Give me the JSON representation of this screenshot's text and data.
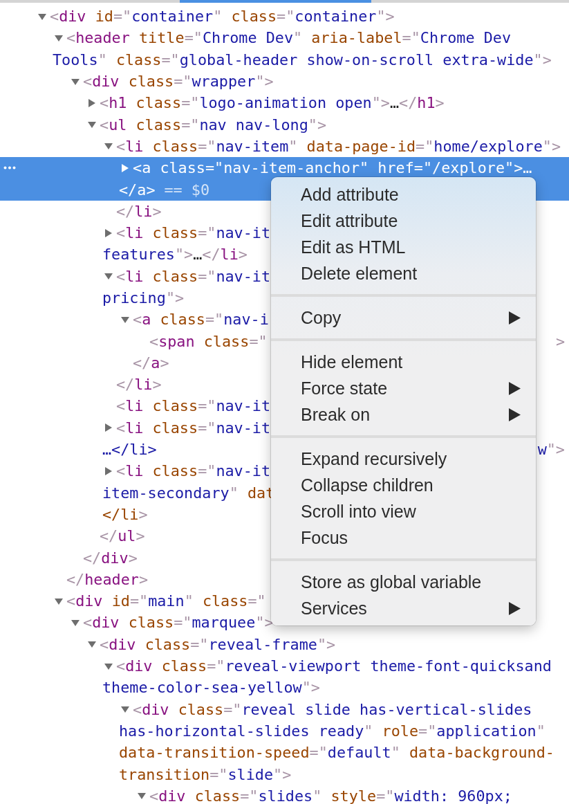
{
  "tree": [
    {
      "kind": "element",
      "expanded": true,
      "selected": false,
      "lines": [
        "<div id=\"container\" class=\"container\">"
      ],
      "children": [
        {
          "kind": "element",
          "expanded": true,
          "selected": false,
          "lines": [
            "<header title=\"Chrome Dev\" aria-label=\"Chrome Dev",
            "Tools\" class=\"global-header show-on-scroll extra-wide\">"
          ],
          "closing": "</header>",
          "children": [
            {
              "kind": "element",
              "expanded": true,
              "selected": false,
              "lines": [
                "<div class=\"wrapper\">"
              ],
              "closing": "</div>",
              "children": [
                {
                  "kind": "element",
                  "expanded": false,
                  "selected": false,
                  "lines": [
                    "<h1 class=\"logo-animation open\">…</h1>"
                  ]
                },
                {
                  "kind": "element",
                  "expanded": true,
                  "selected": false,
                  "lines": [
                    "<ul class=\"nav nav-long\">"
                  ],
                  "closing": "</ul>",
                  "children": [
                    {
                      "kind": "element",
                      "expanded": true,
                      "selected": false,
                      "lines": [
                        "<li class=\"nav-item\" data-page-id=\"home/explore\">"
                      ],
                      "closing": "</li>",
                      "children": [
                        {
                          "kind": "element",
                          "expanded": false,
                          "selected": true,
                          "lines": [
                            "<a class=\"nav-item-anchor\" href=\"/explore\">…",
                            "</a>"
                          ],
                          "marker": "== $0"
                        }
                      ]
                    },
                    {
                      "kind": "element",
                      "expanded": false,
                      "selected": false,
                      "lines": [
                        "<li class=\"nav-it",
                        "features\">…</li>"
                      ]
                    },
                    {
                      "kind": "element",
                      "expanded": true,
                      "selected": false,
                      "lines": [
                        "<li class=\"nav-it",
                        "pricing\">"
                      ],
                      "closing": "</li>",
                      "children": [
                        {
                          "kind": "element",
                          "expanded": true,
                          "selected": false,
                          "lines": [
                            "<a class=\"nav-i"
                          ],
                          "closing": "</a>",
                          "children": [
                            {
                              "kind": "leaf",
                              "selected": false,
                              "lines": [
                                "<span class=\""
                              ],
                              "tail": ">"
                            }
                          ]
                        }
                      ]
                    },
                    {
                      "kind": "leaf",
                      "selected": false,
                      "lines": [
                        "<li class=\"nav-it"
                      ]
                    },
                    {
                      "kind": "element",
                      "expanded": false,
                      "selected": false,
                      "lines": [
                        "<li class=\"nav-it",
                        "…</li>"
                      ],
                      "tail": "w\">"
                    },
                    {
                      "kind": "element",
                      "expanded": false,
                      "selected": false,
                      "lines": [
                        "<li class=\"nav-it",
                        "item-secondary\" dat",
                        "</li>"
                      ]
                    }
                  ]
                }
              ]
            }
          ]
        },
        {
          "kind": "element",
          "expanded": true,
          "selected": false,
          "lines": [
            "<div id=\"main\" class=\""
          ],
          "children": [
            {
              "kind": "element",
              "expanded": true,
              "selected": false,
              "lines": [
                "<div class=\"marquee\">"
              ],
              "children": [
                {
                  "kind": "element",
                  "expanded": true,
                  "selected": false,
                  "lines": [
                    "<div class=\"reveal-frame\">"
                  ],
                  "children": [
                    {
                      "kind": "element",
                      "expanded": true,
                      "selected": false,
                      "lines": [
                        "<div class=\"reveal-viewport theme-font-quicksand",
                        "theme-color-sea-yellow\">"
                      ],
                      "children": [
                        {
                          "kind": "element",
                          "expanded": true,
                          "selected": false,
                          "lines": [
                            "<div class=\"reveal slide has-vertical-slides",
                            "has-horizontal-slides ready\" role=\"application\"",
                            "data-transition-speed=\"default\" data-background-",
                            "transition=\"slide\">"
                          ],
                          "children": [
                            {
                              "kind": "element",
                              "expanded": true,
                              "selected": false,
                              "lines": [
                                "<div class=\"slides\" style=\"width: 960px;"
                              ]
                            }
                          ]
                        }
                      ]
                    }
                  ]
                }
              ]
            }
          ]
        }
      ]
    }
  ],
  "context_menu": {
    "groups": [
      [
        {
          "label": "Add attribute",
          "submenu": false
        },
        {
          "label": "Edit attribute",
          "submenu": false
        },
        {
          "label": "Edit as HTML",
          "submenu": false
        },
        {
          "label": "Delete element",
          "submenu": false
        }
      ],
      [
        {
          "label": "Copy",
          "submenu": true
        }
      ],
      [
        {
          "label": "Hide element",
          "submenu": false
        },
        {
          "label": "Force state",
          "submenu": true
        },
        {
          "label": "Break on",
          "submenu": true
        }
      ],
      [
        {
          "label": "Expand recursively",
          "submenu": false
        },
        {
          "label": "Collapse children",
          "submenu": false
        },
        {
          "label": "Scroll into view",
          "submenu": false
        },
        {
          "label": "Focus",
          "submenu": false
        }
      ],
      [
        {
          "label": "Store as global variable",
          "submenu": false
        },
        {
          "label": "Services",
          "submenu": true
        }
      ]
    ]
  }
}
